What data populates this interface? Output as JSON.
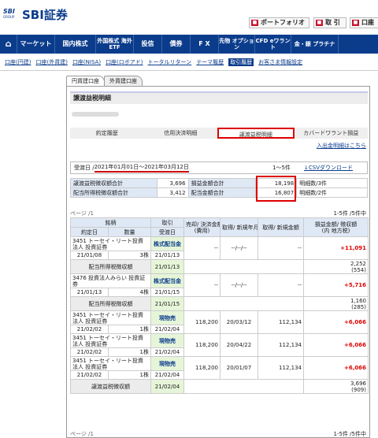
{
  "brand": {
    "mark": "SBI",
    "mark_sub": "GROUP",
    "name": "SBI証券"
  },
  "topbar": [
    "ポートフォリオ",
    "取 引",
    "口座"
  ],
  "nav": [
    {
      "label": "マーケット"
    },
    {
      "label": "国内株式"
    },
    {
      "label": "外国株式 海外ETF",
      "small": true
    },
    {
      "label": "投信"
    },
    {
      "label": "債券"
    },
    {
      "label": "F X"
    },
    {
      "label": "先物 オプション",
      "small": true
    },
    {
      "label": "CFD eワラント",
      "small": true
    },
    {
      "label": "金・銀 プラチナ",
      "small": true
    }
  ],
  "subnav": [
    "口座(円建)",
    "口座(外貨建)",
    "口座(NISA)",
    "口座(ロボアド)",
    "トータルリターン",
    "テーマ履歴",
    "取引履歴",
    "お客さま情報設定"
  ],
  "subnav_current": 6,
  "tabs": [
    "円貨建口座",
    "外貨建口座"
  ],
  "page_title": "譲渡益税明細",
  "btabs": [
    "約定履歴",
    "信用決済明細",
    "譲渡益税明細",
    "カバードワラント損益"
  ],
  "btabs_current": 2,
  "link_income": "入出金明細はこちら",
  "period": {
    "label": "受渡日 / ",
    "range": "2021年01月01日～2021年03月12日",
    "count": "1〜5件",
    "csv": "↓CSVダウンロード"
  },
  "summary": [
    [
      "譲渡益税徴収額合計",
      "3,696",
      "損益金額合計",
      "18,198",
      "明細数/3件"
    ],
    [
      "配当所得税徴収額合計",
      "3,412",
      "配当金額合計",
      "16,807",
      "明細数/2件"
    ]
  ],
  "page_left": "ページ /1",
  "page_right": "1-5件 /5件中",
  "headers": {
    "row1": [
      "銘柄",
      "取引",
      "売却/ 決済金額",
      "取得/ 新規年月日",
      "取得/ 新規金額",
      "損益金額/ 徴収額"
    ],
    "row2": [
      "約定日",
      "数量",
      "受渡日",
      "(費用)",
      "",
      "(内 地方税)"
    ]
  },
  "rows": [
    {
      "name": "3451 トーセイ・リート投資法人 投資証券",
      "trade_date": "21/01/08",
      "qty": "3株",
      "trade": "株式配当金",
      "settle": "21/01/13",
      "amount": "--",
      "cost": "--",
      "acq_date": "--/--/--",
      "acq_amount": "--",
      "pl": "+11,091",
      "tax_label": "配当所得税徴収額",
      "tax_settle": "21/01/13",
      "tax": "2,252",
      "tax_local": "(554)"
    },
    {
      "name": "3476 投資法人みらい 投資証券",
      "trade_date": "21/01/13",
      "qty": "4株",
      "trade": "株式配当金",
      "settle": "21/01/15",
      "amount": "--",
      "cost": "--",
      "acq_date": "--/--/--",
      "acq_amount": "--",
      "pl": "+5,716",
      "tax_label": "配当所得税徴収額",
      "tax_settle": "21/01/15",
      "tax": "1,160",
      "tax_local": "(285)"
    },
    {
      "name": "3451 トーセイ・リート投資法人 投資証券",
      "trade_date": "21/02/02",
      "qty": "1株",
      "trade": "現物売",
      "settle": "21/02/04",
      "amount": "118,200",
      "cost": "--",
      "acq_date": "20/03/12",
      "acq_amount": "112,134",
      "pl": "+6,066"
    },
    {
      "name": "3451 トーセイ・リート投資法人 投資証券",
      "trade_date": "21/02/02",
      "qty": "1株",
      "trade": "現物売",
      "settle": "21/02/04",
      "amount": "118,200",
      "cost": "--",
      "acq_date": "20/04/22",
      "acq_amount": "112,134",
      "pl": "+6,066"
    },
    {
      "name": "3451 トーセイ・リート投資法人 投資証券",
      "trade_date": "21/02/02",
      "qty": "1株",
      "trade": "現物売",
      "settle": "21/02/04",
      "amount": "118,200",
      "cost": "--",
      "acq_date": "20/01/07",
      "acq_amount": "112,134",
      "pl": "+6,066"
    }
  ],
  "final_tax": {
    "label": "譲渡益税徴収額",
    "settle": "21/02/04",
    "tax": "3,696",
    "tax_local": "(909)"
  },
  "page_left2": "ページ /1",
  "page_right2": "1-5件 /5件中"
}
